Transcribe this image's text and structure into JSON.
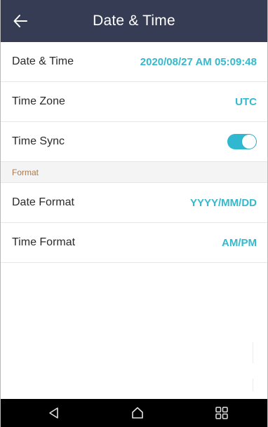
{
  "header": {
    "title": "Date & Time",
    "back_icon": "arrow-left-icon"
  },
  "settings": [
    {
      "label": "Date & Time",
      "value": "2020/08/27 AM 05:09:48"
    },
    {
      "label": "Time Zone",
      "value": "UTC"
    },
    {
      "label": "Time Sync",
      "toggle": true
    }
  ],
  "format_section": {
    "title": "Format",
    "items": [
      {
        "label": "Date Format",
        "value": "YYYY/MM/DD"
      },
      {
        "label": "Time Format",
        "value": "AM/PM"
      }
    ]
  },
  "navbar": {
    "icons": [
      "back-triangle-icon",
      "home-icon",
      "recent-apps-icon"
    ]
  },
  "colors": {
    "header_bg": "#353c54",
    "accent": "#35b9cc",
    "section_text": "#a9794d",
    "section_bg": "#f4f4f4",
    "navbar_bg": "#000000"
  }
}
